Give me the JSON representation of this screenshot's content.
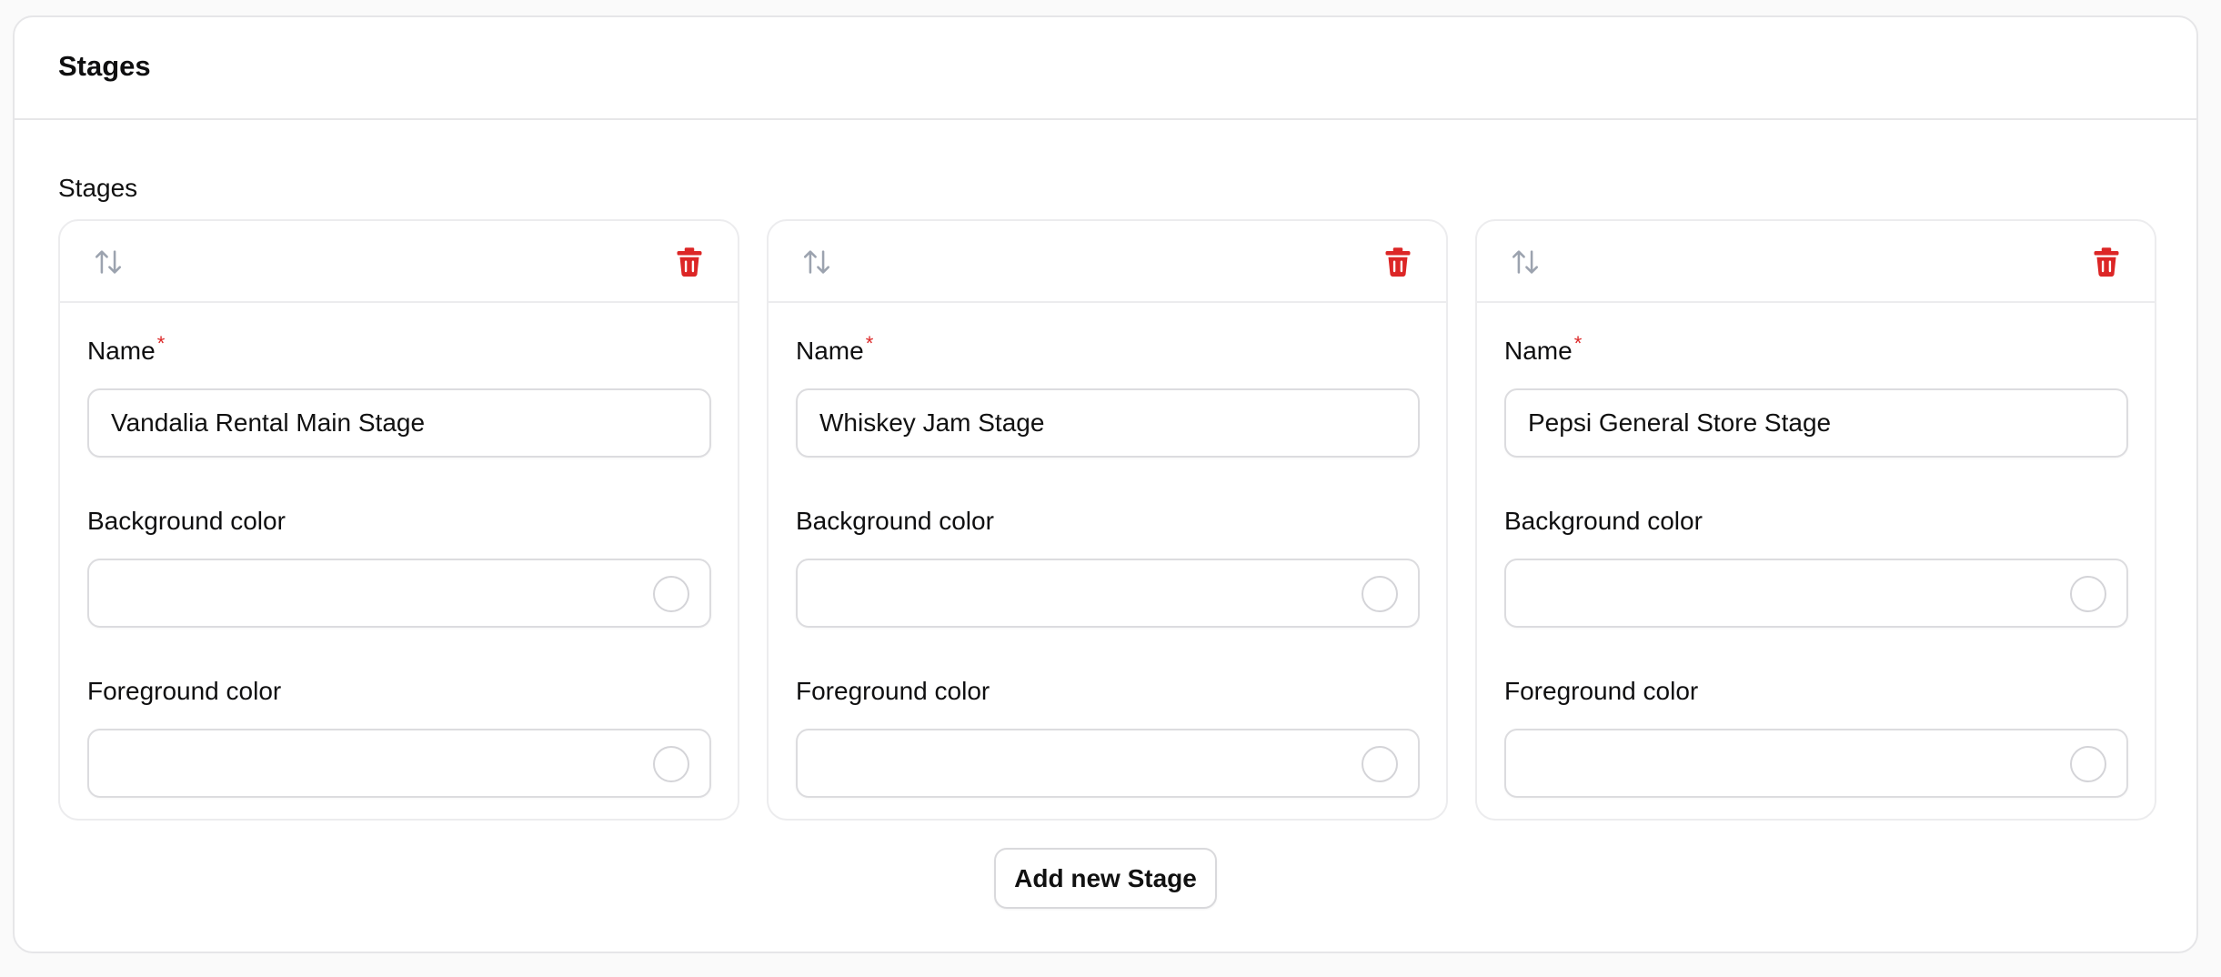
{
  "panel": {
    "title": "Stages"
  },
  "section": {
    "label": "Stages"
  },
  "labels": {
    "name": "Name",
    "required_mark": "*",
    "background_color": "Background color",
    "foreground_color": "Foreground color"
  },
  "stages": [
    {
      "name": "Vandalia Rental Main Stage",
      "background_color": "",
      "foreground_color": ""
    },
    {
      "name": "Whiskey Jam Stage",
      "background_color": "",
      "foreground_color": ""
    },
    {
      "name": "Pepsi General Store Stage",
      "background_color": "",
      "foreground_color": ""
    }
  ],
  "icons": {
    "reorder": "arrows-up-down-icon",
    "delete": "trash-icon"
  },
  "colors": {
    "danger": "#dc2626",
    "icon_muted": "#9ca3af",
    "border": "#e6e6e8"
  },
  "actions": {
    "add_label": "Add new Stage"
  }
}
